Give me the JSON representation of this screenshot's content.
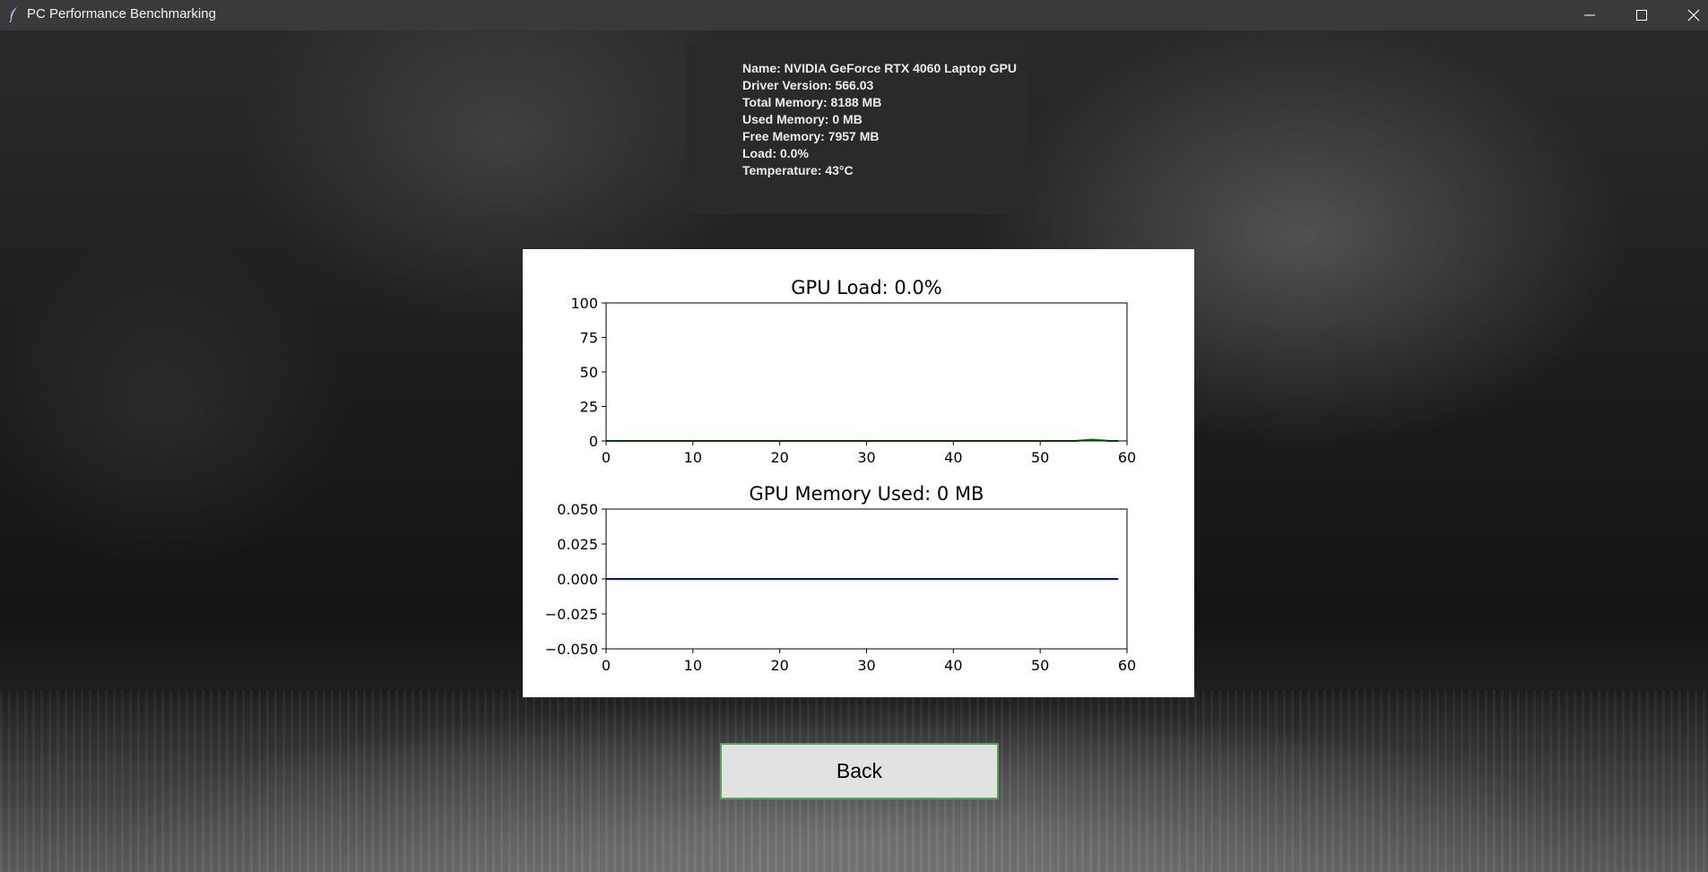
{
  "window": {
    "title": "PC Performance Benchmarking"
  },
  "gpu_info": {
    "lines": [
      "Name: NVIDIA GeForce RTX 4060 Laptop GPU",
      "Driver Version: 566.03",
      "Total Memory: 8188 MB",
      "Used Memory: 0 MB",
      "Free Memory: 7957 MB",
      "Load: 0.0%",
      "Temperature: 43°C"
    ]
  },
  "chart_data": [
    {
      "type": "line",
      "title": "GPU Load: 0.0%",
      "xlabel": "",
      "ylabel": "",
      "xlim": [
        0,
        60
      ],
      "ylim": [
        0,
        100
      ],
      "xticks": [
        0,
        10,
        20,
        30,
        40,
        50,
        60
      ],
      "xtick_labels": [
        "0",
        "10",
        "20",
        "30",
        "40",
        "50",
        "60"
      ],
      "yticks": [
        0,
        25,
        50,
        75,
        100
      ],
      "ytick_labels": [
        "0",
        "25",
        "50",
        "75",
        "100"
      ],
      "grid": false,
      "series": [
        {
          "color": "#008000",
          "x": [
            0,
            5,
            10,
            15,
            20,
            25,
            30,
            35,
            40,
            45,
            50,
            54,
            55,
            56,
            57,
            58,
            59
          ],
          "y": [
            0,
            0,
            0,
            0,
            0,
            0,
            0,
            0,
            0,
            0,
            0,
            0,
            0.5,
            1,
            0.5,
            0,
            0
          ]
        }
      ]
    },
    {
      "type": "line",
      "title": "GPU Memory Used: 0 MB",
      "xlabel": "",
      "ylabel": "",
      "xlim": [
        0,
        60
      ],
      "ylim": [
        -0.05,
        0.05
      ],
      "xticks": [
        0,
        10,
        20,
        30,
        40,
        50,
        60
      ],
      "xtick_labels": [
        "0",
        "10",
        "20",
        "30",
        "40",
        "50",
        "60"
      ],
      "yticks": [
        -0.05,
        -0.025,
        0,
        0.025,
        0.05
      ],
      "ytick_labels": [
        "−0.050",
        "−0.025",
        "0.000",
        "0.025",
        "0.050"
      ],
      "grid": false,
      "series": [
        {
          "color": "#0000ff",
          "x": [
            0,
            59
          ],
          "y": [
            0,
            0
          ]
        }
      ]
    }
  ],
  "back_button": {
    "label": "Back"
  },
  "colors": {
    "titlebar": "#3a3a3a",
    "panel": "#2a2a2a",
    "load_line": "#008000",
    "memory_line": "#0000ff",
    "button_border": "#5aa05a"
  }
}
